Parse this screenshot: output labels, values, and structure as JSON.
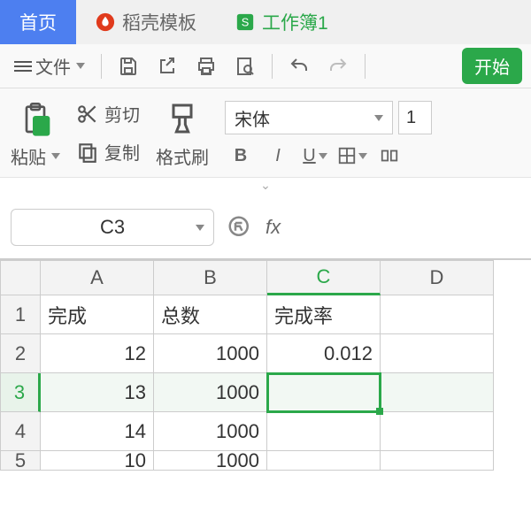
{
  "tabs": {
    "home": "首页",
    "tpl": "稻壳模板",
    "doc": "工作簿1",
    "tpl_icon_color": "#e03a1c",
    "doc_icon_color": "#2ba84a"
  },
  "toolbar": {
    "file": "文件",
    "start": "开始"
  },
  "ribbon": {
    "paste": "粘贴",
    "cut": "剪切",
    "copy": "复制",
    "format_painter": "格式刷",
    "font_name": "宋体",
    "font_size": "1",
    "bold": "B",
    "italic": "I",
    "underline": "U"
  },
  "namebox": "C3",
  "fx": "fx",
  "columns": [
    "A",
    "B",
    "C",
    "D"
  ],
  "rows": [
    "1",
    "2",
    "3",
    "4",
    "5"
  ],
  "cells": {
    "A1": "完成",
    "B1": "总数",
    "C1": "完成率",
    "A2": "12",
    "B2": "1000",
    "C2": "0.012",
    "A3": "13",
    "B3": "1000",
    "A4": "14",
    "B4": "1000",
    "A5": "10",
    "B5": "1000"
  },
  "active_cell": "C3",
  "active_col": "C",
  "active_row": "3"
}
